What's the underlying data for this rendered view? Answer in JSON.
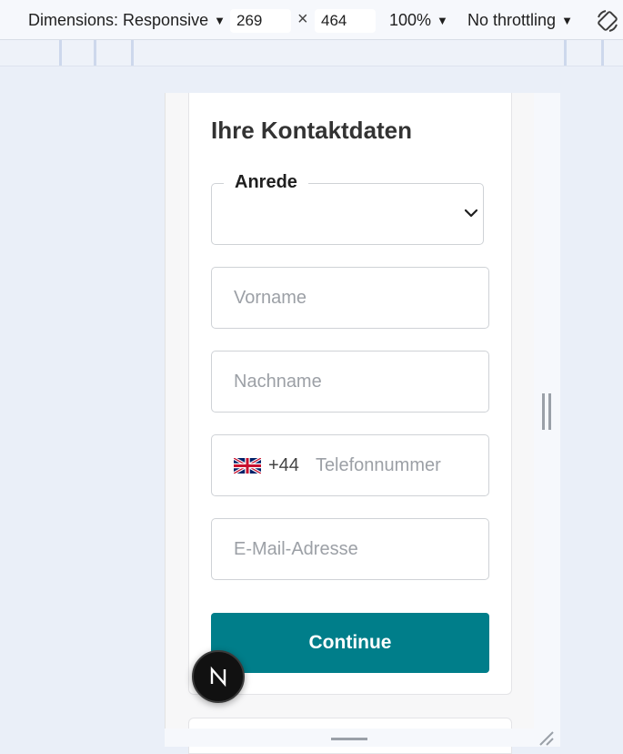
{
  "devtools": {
    "dimensions_label": "Dimensions: Responsive",
    "width_value": "269",
    "times_sign": "×",
    "height_value": "464",
    "zoom_label": "100%",
    "throttling_label": "No throttling"
  },
  "form": {
    "title": "Ihre Kontaktdaten",
    "salutation": {
      "label": "Anrede",
      "value": ""
    },
    "first_name": {
      "value": "",
      "placeholder": "Vorname"
    },
    "last_name": {
      "value": "",
      "placeholder": "Nachname"
    },
    "phone": {
      "country": "gb-flag-icon",
      "dial_code": "+44",
      "value": "",
      "placeholder": "Telefonnummer"
    },
    "email": {
      "value": "",
      "placeholder": "E-Mail-Adresse"
    },
    "continue_label": "Continue"
  },
  "next_badge": {
    "letter": "N"
  },
  "colors": {
    "primary_button": "#007e8a",
    "page_background": "#eaeff8",
    "toolbar_background": "#f6f8fc"
  }
}
